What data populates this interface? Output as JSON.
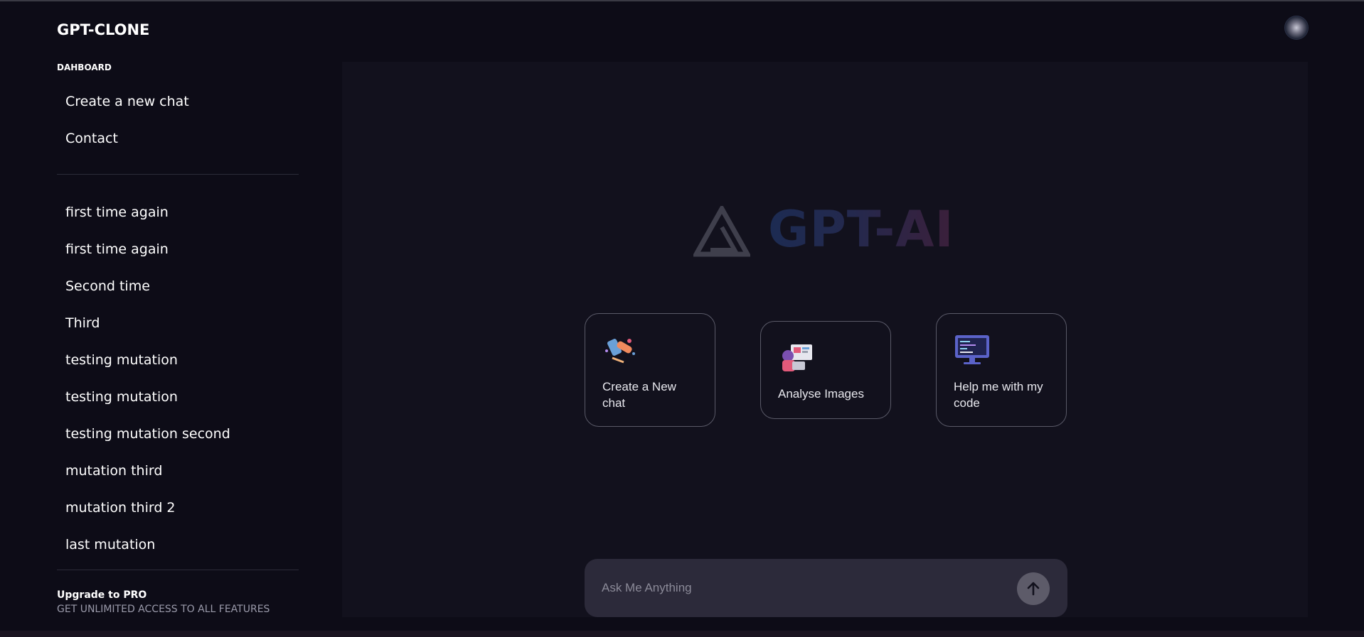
{
  "app": {
    "title": "GPT-CLONE"
  },
  "sidebar": {
    "section_label": "DAHBOARD",
    "actions": [
      {
        "label": "Create a new chat"
      },
      {
        "label": "Contact"
      }
    ],
    "chats": [
      {
        "label": "first time again"
      },
      {
        "label": "first time again"
      },
      {
        "label": "Second time"
      },
      {
        "label": "Third"
      },
      {
        "label": "testing mutation"
      },
      {
        "label": "testing mutation"
      },
      {
        "label": "testing mutation second"
      },
      {
        "label": "mutation third"
      },
      {
        "label": "mutation third 2"
      },
      {
        "label": "last mutation"
      }
    ],
    "upgrade": {
      "title": "Upgrade to PRO",
      "subtitle": "GET UNLIMITED ACCESS TO ALL FEATURES"
    }
  },
  "main": {
    "brand": "GPT-AI",
    "cards": [
      {
        "label": "Create a New chat",
        "icon": "chat-illustration-icon"
      },
      {
        "label": "Analyse Images",
        "icon": "image-analysis-illustration-icon"
      },
      {
        "label": "Help me with my code",
        "icon": "code-monitor-illustration-icon"
      }
    ],
    "composer": {
      "placeholder": "Ask Me Anything",
      "send_icon": "arrow-up-icon"
    }
  },
  "colors": {
    "background": "#0d0c17",
    "panel": "#12111d",
    "composer": "#2c2a3a",
    "brand_gradient_start": "#1c2b52",
    "brand_gradient_end": "#3b1f3a"
  }
}
